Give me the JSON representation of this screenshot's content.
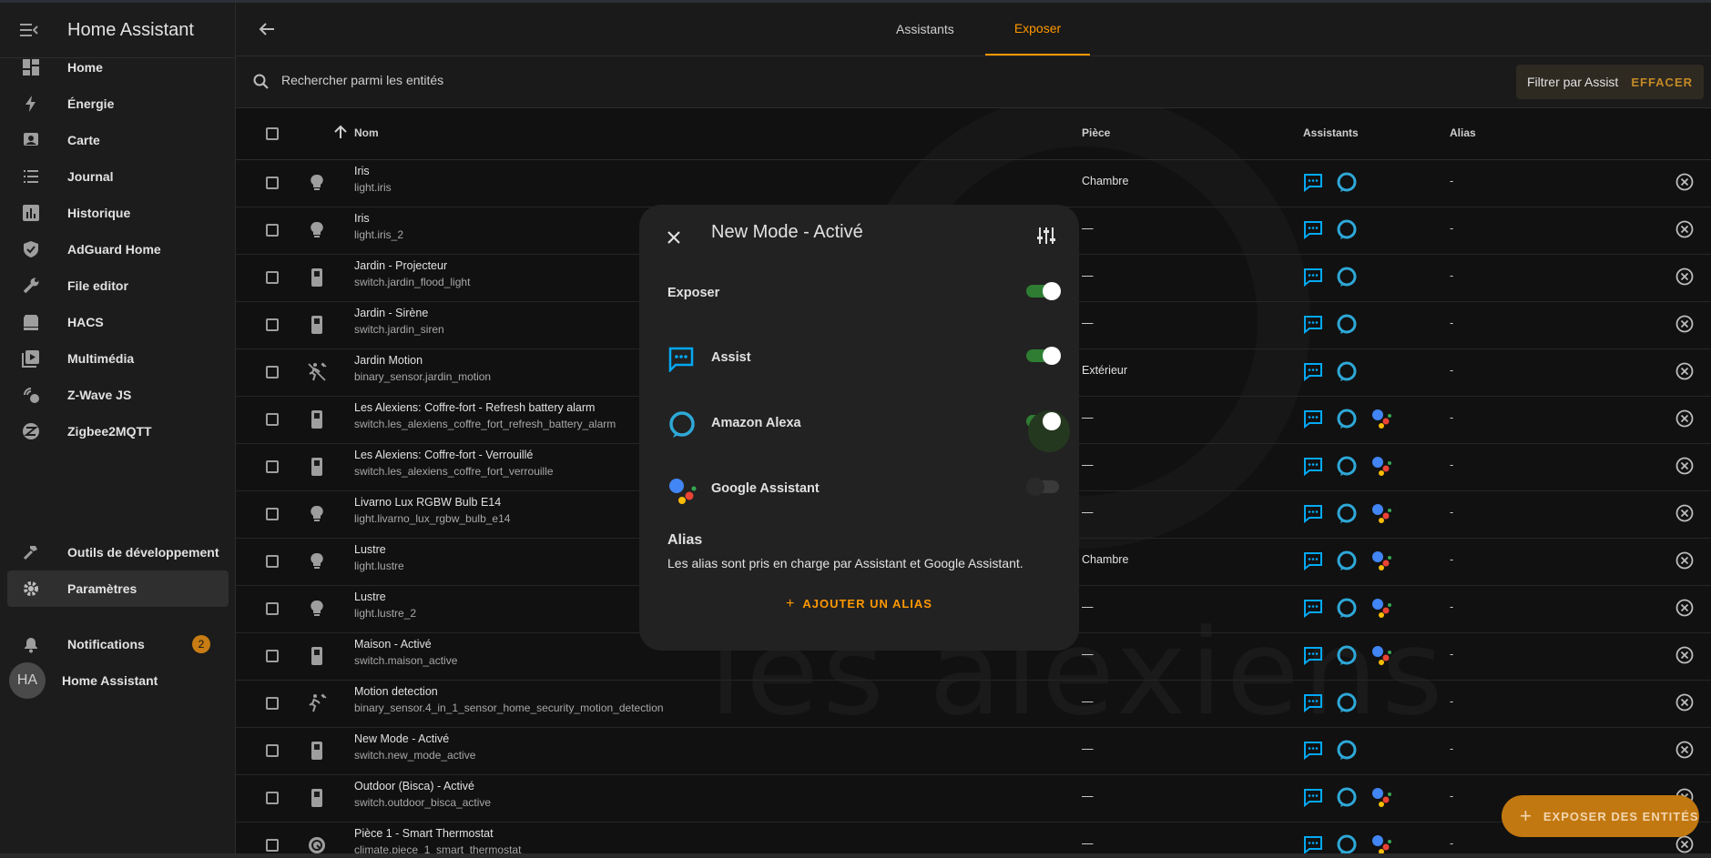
{
  "app": {
    "title": "Home Assistant"
  },
  "sidebar": {
    "items": [
      {
        "label": "Home",
        "icon": "dashboard-icon"
      },
      {
        "label": "Énergie",
        "icon": "lightning-icon"
      },
      {
        "label": "Carte",
        "icon": "map-icon"
      },
      {
        "label": "Journal",
        "icon": "list-icon"
      },
      {
        "label": "Historique",
        "icon": "chart-icon"
      },
      {
        "label": "AdGuard Home",
        "icon": "shield-icon"
      },
      {
        "label": "File editor",
        "icon": "wrench-icon"
      },
      {
        "label": "HACS",
        "icon": "hacs-icon"
      },
      {
        "label": "Multimédia",
        "icon": "media-icon"
      },
      {
        "label": "Z-Wave JS",
        "icon": "zwave-icon"
      },
      {
        "label": "Zigbee2MQTT",
        "icon": "zigbee-icon"
      }
    ],
    "dev_tools": "Outils de développement",
    "settings": "Paramètres",
    "notifications": "Notifications",
    "notifications_count": "2",
    "user_initials": "HA",
    "user_name": "Home Assistant"
  },
  "tabs": {
    "assistants": "Assistants",
    "exposer": "Exposer"
  },
  "search": {
    "placeholder": "Rechercher parmi les entités"
  },
  "filter": {
    "label": "Filtrer par Assist",
    "clear": "EFFACER"
  },
  "table": {
    "headers": {
      "name": "Nom",
      "area": "Pièce",
      "assistants": "Assistants",
      "alias": "Alias"
    },
    "rows": [
      {
        "name": "Iris",
        "entity": "light.iris",
        "area": "Chambre",
        "alias": "-",
        "icon": "bulb-icon",
        "google": false
      },
      {
        "name": "Iris",
        "entity": "light.iris_2",
        "area": "—",
        "alias": "-",
        "icon": "bulb-icon",
        "google": false
      },
      {
        "name": "Jardin - Projecteur",
        "entity": "switch.jardin_flood_light",
        "area": "—",
        "alias": "-",
        "icon": "switch-icon",
        "google": false
      },
      {
        "name": "Jardin - Sirène",
        "entity": "switch.jardin_siren",
        "area": "—",
        "alias": "-",
        "icon": "switch-icon",
        "google": false
      },
      {
        "name": "Jardin Motion",
        "entity": "binary_sensor.jardin_motion",
        "area": "Extérieur",
        "alias": "-",
        "icon": "motion-off-icon",
        "google": false
      },
      {
        "name": "Les Alexiens: Coffre-fort - Refresh battery alarm",
        "entity": "switch.les_alexiens_coffre_fort_refresh_battery_alarm",
        "area": "—",
        "alias": "-",
        "icon": "switch-icon",
        "google": true
      },
      {
        "name": "Les Alexiens: Coffre-fort - Verrouillé",
        "entity": "switch.les_alexiens_coffre_fort_verrouille",
        "area": "—",
        "alias": "-",
        "icon": "switch-icon",
        "google": true
      },
      {
        "name": "Livarno Lux RGBW Bulb E14",
        "entity": "light.livarno_lux_rgbw_bulb_e14",
        "area": "—",
        "alias": "-",
        "icon": "bulb-icon",
        "google": true
      },
      {
        "name": "Lustre",
        "entity": "light.lustre",
        "area": "Chambre",
        "alias": "-",
        "icon": "bulb-icon",
        "google": true
      },
      {
        "name": "Lustre",
        "entity": "light.lustre_2",
        "area": "—",
        "alias": "-",
        "icon": "bulb-icon",
        "google": true
      },
      {
        "name": "Maison - Activé",
        "entity": "switch.maison_active",
        "area": "—",
        "alias": "-",
        "icon": "switch-icon",
        "google": true
      },
      {
        "name": "Motion detection",
        "entity": "binary_sensor.4_in_1_sensor_home_security_motion_detection",
        "area": "—",
        "alias": "-",
        "icon": "motion-icon",
        "google": false
      },
      {
        "name": "New Mode - Activé",
        "entity": "switch.new_mode_active",
        "area": "—",
        "alias": "-",
        "icon": "switch-icon",
        "google": false
      },
      {
        "name": "Outdoor (Bisca) - Activé",
        "entity": "switch.outdoor_bisca_active",
        "area": "—",
        "alias": "-",
        "icon": "switch-icon",
        "google": true
      },
      {
        "name": "Pièce 1 - Smart Thermostat",
        "entity": "climate.piece_1_smart_thermostat",
        "area": "—",
        "alias": "-",
        "icon": "thermostat-icon",
        "google": true
      }
    ]
  },
  "watermark": "les alexiens",
  "dialog": {
    "title": "New Mode - Activé",
    "expose_label": "Exposer",
    "expose_on": true,
    "assist_label": "Assist",
    "assist_on": true,
    "alexa_label": "Amazon Alexa",
    "alexa_on": true,
    "google_label": "Google Assistant",
    "google_on": false,
    "alias_heading": "Alias",
    "alias_text": "Les alias sont pris en charge par Assistant et Google Assistant.",
    "add_alias": "AJOUTER UN ALIAS"
  },
  "fab": {
    "label": "EXPOSER DES ENTITÉS"
  },
  "colors": {
    "accent": "#ff9800",
    "assist": "#03a9f4",
    "toggle_on": "#2e7d32"
  }
}
